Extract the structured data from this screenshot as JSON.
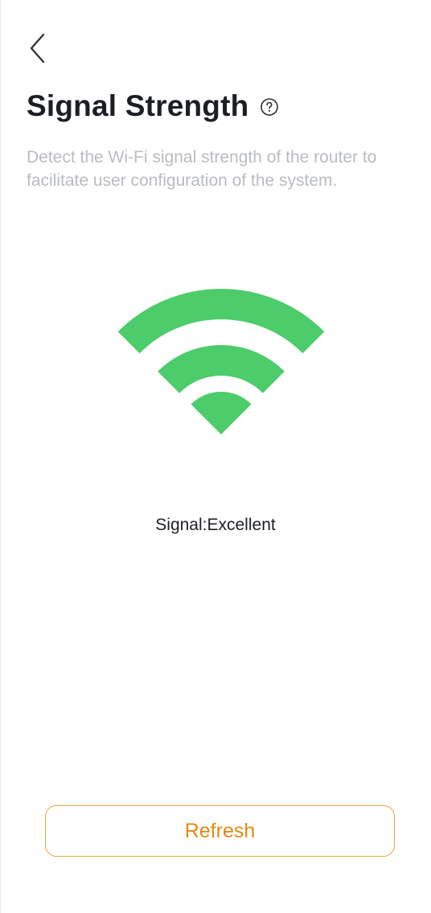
{
  "header": {
    "back_icon": "chevron-left-icon",
    "title": "Signal Strength",
    "help_icon": "question-circle-icon"
  },
  "description": "Detect the Wi-Fi signal strength of the router to facilitate user configuration of the system.",
  "signal": {
    "icon": "wifi-signal-icon",
    "color": "#4ccc6a",
    "level_bars": 3,
    "max_bars": 3,
    "status_text": "Signal:Excellent"
  },
  "actions": {
    "refresh_label": "Refresh",
    "accent_color": "#e08a14"
  }
}
